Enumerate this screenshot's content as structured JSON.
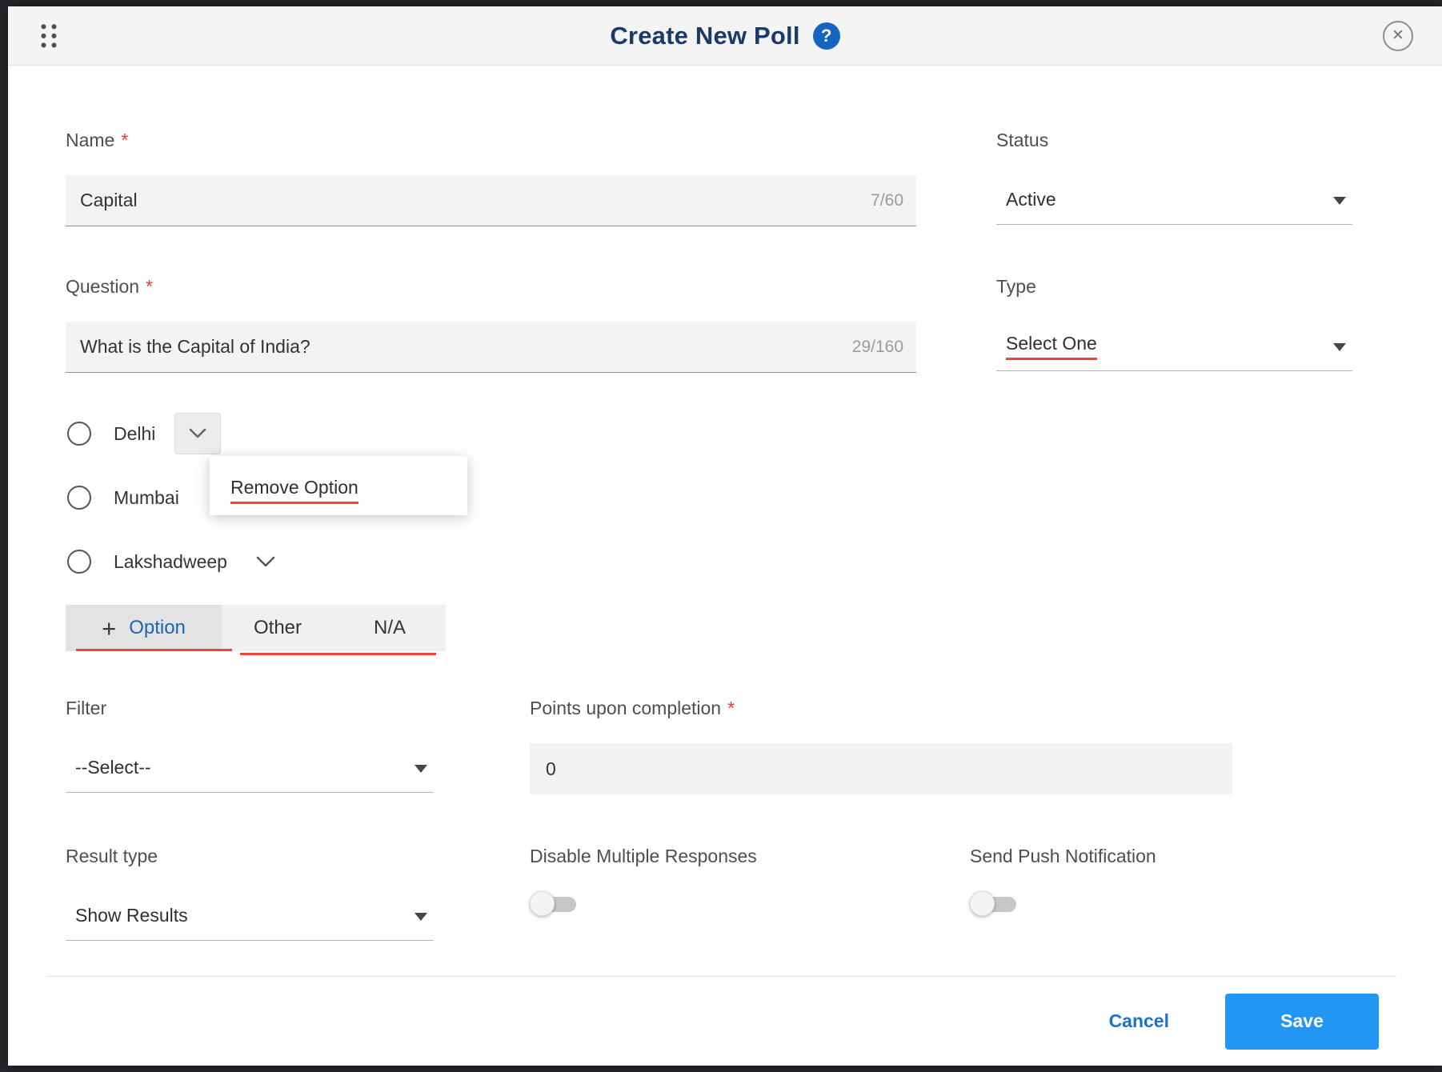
{
  "header": {
    "title": "Create New Poll",
    "help_glyph": "?",
    "close_glyph": "✕"
  },
  "fields": {
    "name": {
      "label": "Name",
      "required_mark": "*",
      "value": "Capital",
      "counter": "7/60"
    },
    "question": {
      "label": "Question",
      "required_mark": "*",
      "value": "What is the Capital of India?",
      "counter": "29/160"
    },
    "status": {
      "label": "Status",
      "value": "Active"
    },
    "type": {
      "label": "Type",
      "value": "Select One"
    },
    "filter": {
      "label": "Filter",
      "value": "--Select--"
    },
    "points": {
      "label": "Points upon completion",
      "required_mark": "*",
      "value": "0"
    },
    "result_type": {
      "label": "Result type",
      "value": "Show Results"
    },
    "disable_multiple_responses": {
      "label": "Disable Multiple Responses",
      "state": "off"
    },
    "send_push_notification": {
      "label": "Send Push Notification",
      "state": "off"
    }
  },
  "options": [
    {
      "label": "Delhi"
    },
    {
      "label": "Mumbai"
    },
    {
      "label": "Lakshadweep"
    }
  ],
  "option_menu": {
    "remove_label": "Remove Option"
  },
  "add_bar": {
    "plus_glyph": "+",
    "option_label": "Option",
    "other_label": "Other",
    "na_label": "N/A"
  },
  "footer": {
    "cancel_label": "Cancel",
    "save_label": "Save"
  },
  "colors": {
    "title_navy": "#1b3a66",
    "accent_blue": "#1565c0",
    "save_blue": "#2196f3",
    "annotation_red": "#f44336"
  }
}
